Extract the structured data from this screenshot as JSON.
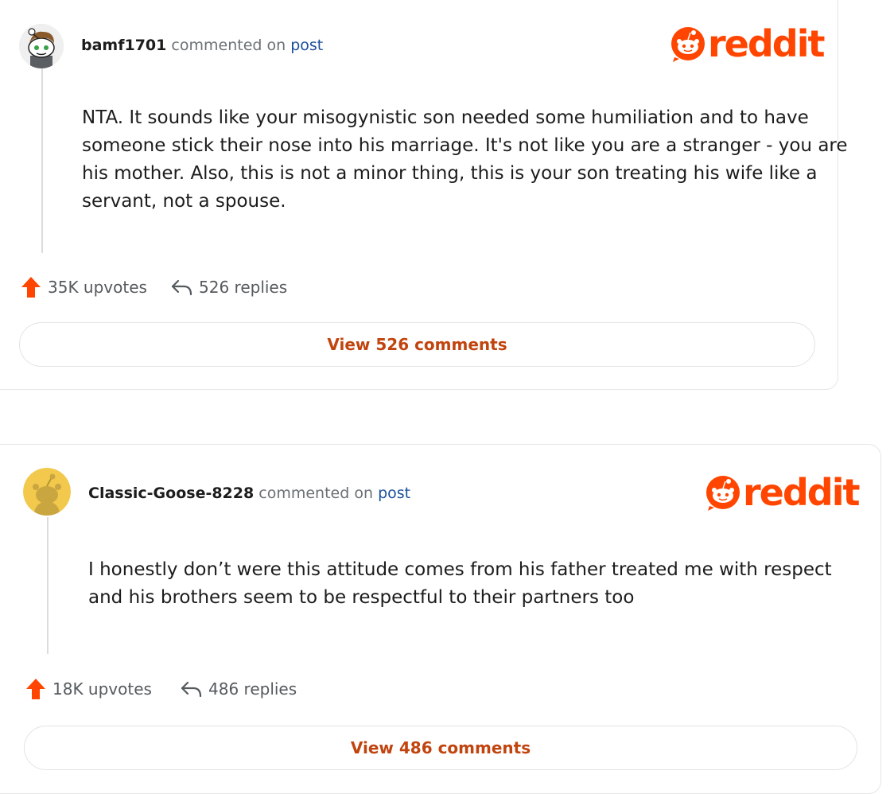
{
  "colors": {
    "reddit_orange": "#ff4500",
    "link_blue": "#1a4f9c",
    "button_text": "#c1440e",
    "meta_gray": "#6b7176"
  },
  "brand": {
    "logo_text": "reddit",
    "logo_icon": "snoo-icon"
  },
  "comments": [
    {
      "username": "bamf1701",
      "commented_label": "commented on",
      "post_label": "post",
      "avatar_icon": "snoo-avatar-icon",
      "body_lines": [
        "NTA. It sounds like your misogynistic son needed some humiliation and to have",
        "someone stick their nose into his marriage. It's not like you are a stranger - you are",
        "his mother. Also, this is not a minor thing, this is your son treating his wife like a",
        "servant, not a spouse."
      ],
      "upvotes": "35K upvotes",
      "replies": "526 replies",
      "view_button": "View 526 comments"
    },
    {
      "username": "Classic-Goose-8228",
      "commented_label": "commented on",
      "post_label": "post",
      "avatar_icon": "snoo-avatar-icon",
      "body_lines": [
        "I honestly don’t were this attitude comes from his father treated me with respect",
        "and his brothers seem to be respectful to their partners too"
      ],
      "upvotes": "18K upvotes",
      "replies": "486 replies",
      "view_button": "View 486 comments"
    }
  ]
}
